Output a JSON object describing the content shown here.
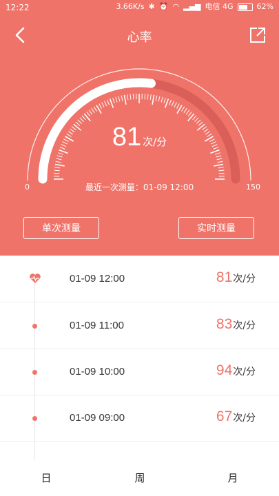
{
  "status": {
    "time": "12:22",
    "speed": "3.66K/s",
    "carrier": "电信 4G",
    "battery": "62%"
  },
  "header": {
    "title": "心率"
  },
  "gauge": {
    "value": "81",
    "unit": "次/分",
    "min": "0",
    "max": "150",
    "level_fraction": 0.54,
    "last_measured": "最近一次测量：01-09 12:00"
  },
  "buttons": {
    "single": "单次测量",
    "live": "实时测量"
  },
  "records": [
    {
      "time": "01-09 12:00",
      "value": "81",
      "unit": "次/分",
      "marker": "heart-icon"
    },
    {
      "time": "01-09 11:00",
      "value": "83",
      "unit": "次/分",
      "marker": "dot"
    },
    {
      "time": "01-09 10:00",
      "value": "94",
      "unit": "次/分",
      "marker": "dot"
    },
    {
      "time": "01-09 09:00",
      "value": "67",
      "unit": "次/分",
      "marker": "dot"
    }
  ],
  "tabs": [
    "日",
    "周",
    "月"
  ],
  "colors": {
    "accent": "#ef7369",
    "gauge_track": "#d95f58"
  }
}
